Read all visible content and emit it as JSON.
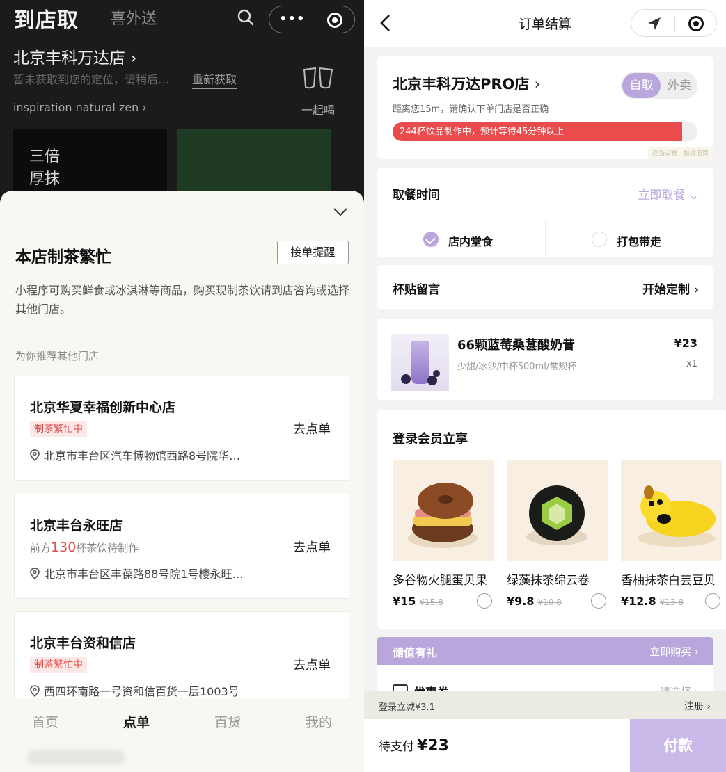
{
  "left": {
    "header": {
      "title": "到店取",
      "subtitle": "喜外送",
      "store_name": "北京丰科万达店 ›",
      "location_text": "暂未获取到您的定位，请稍后…",
      "refetch_label": "重新获取",
      "inspiration": "inspiration natural zen ›",
      "drink_together": "一起喝",
      "banner_text_1": "三倍",
      "banner_text_2": "厚抹"
    },
    "sheet": {
      "busy_title": "本店制茶繁忙",
      "remind_button": "接单提醒",
      "description": "小程序可购买鲜食或冰淇淋等商品，购买现制茶饮请到店咨询或选择其他门店。",
      "recommend_heading": "为你推荐其他门店",
      "stores": [
        {
          "name": "北京华夏幸福创新中心店",
          "tag": "制茶繁忙中",
          "address": "北京市丰台区汽车博物馆西路8号院华…",
          "action": "去点单"
        },
        {
          "name": "北京丰台永旺店",
          "queue_prefix": "前方",
          "queue_num": "130",
          "queue_suffix": "杯茶饮待制作",
          "address": "北京市丰台区丰葆路88号院1号楼永旺…",
          "action": "去点单"
        },
        {
          "name": "北京丰台资和信店",
          "tag": "制茶繁忙中",
          "address": "西四环南路一号资和信百货一层1003号",
          "action": "去点单"
        }
      ]
    },
    "tabs": [
      "首页",
      "点单",
      "百货",
      "我的"
    ],
    "active_tab": "点单"
  },
  "right": {
    "nav_title": "订单结算",
    "store": {
      "name": "北京丰科万达PRO店",
      "chevron": "›",
      "distance_note": "距离您15m，请确认下单门店是否正确",
      "mode_on": "自取",
      "mode_off": "外卖",
      "queue_text": "244杯饮品制作中，预计等待45分钟以上",
      "queue_fill": 0.95,
      "queue_note": "适当点餐，拒绝浪费"
    },
    "pickup": {
      "label": "取餐时间",
      "value": "立即取餐 ⌄",
      "dine_in": "店内堂食",
      "takeaway": "打包带走"
    },
    "sticker": {
      "label": "杯贴留言",
      "action": "开始定制 ›"
    },
    "product": {
      "name": "66颗蓝莓桑葚酸奶昔",
      "spec": "少甜/冰沙/中杯500ml/常规杯",
      "price": "¥23",
      "qty": "x1"
    },
    "member": {
      "heading": "登录会员立享",
      "items": [
        {
          "name": "多谷物火腿蛋贝果",
          "price": "¥15",
          "old": "¥15.8"
        },
        {
          "name": "绿藻抹茶绵云卷",
          "price": "¥9.8",
          "old": "¥10.8"
        },
        {
          "name": "香柚抹茶白芸豆贝",
          "price": "¥12.8",
          "old": "¥13.8"
        }
      ]
    },
    "stored_value": {
      "label": "储值有礼",
      "action": "立即购买 ›"
    },
    "coupon": {
      "label": "优惠券",
      "action": "请选择 ›"
    },
    "login_bar": {
      "text": "登录立减¥3.1",
      "action": "注册 ›"
    },
    "pay": {
      "label": "待支付",
      "amount": "¥23",
      "button": "付款"
    }
  },
  "colors": {
    "accent": "#b9a6dd",
    "alert": "#ea4c4e",
    "dark": "#1b1b1b"
  }
}
